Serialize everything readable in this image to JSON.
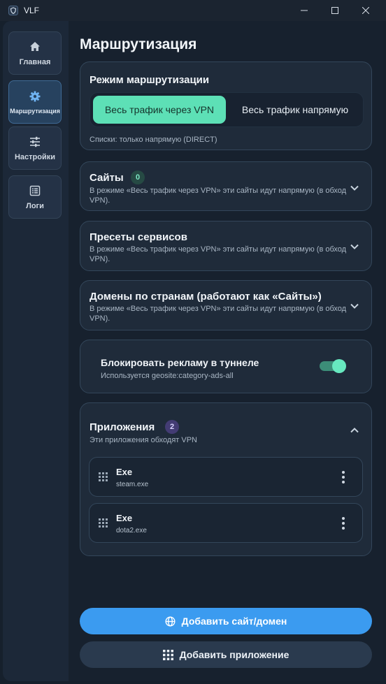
{
  "window": {
    "title": "VLF"
  },
  "sidebar": {
    "items": [
      {
        "label": "Главная",
        "icon": "home-icon"
      },
      {
        "label": "Маршрутизация",
        "icon": "gear-icon"
      },
      {
        "label": "Настройки",
        "icon": "sliders-icon"
      },
      {
        "label": "Логи",
        "icon": "list-icon"
      }
    ],
    "active_index": 1
  },
  "page": {
    "title": "Маршрутизация"
  },
  "routing_mode": {
    "title": "Режим маршрутизации",
    "options": [
      "Весь трафик через VPN",
      "Весь трафик напрямую"
    ],
    "selected": "Весь трафик через VPN",
    "note": "Списки: только напрямую (DIRECT)"
  },
  "sites": {
    "title": "Сайты",
    "count": "0",
    "description": "В режиме «Весь трафик через VPN» эти сайты идут напрямую (в обход VPN)."
  },
  "presets": {
    "title": "Пресеты сервисов",
    "description": "В режиме «Весь трафик через VPN» эти сайты идут напрямую (в обход VPN)."
  },
  "country_domains": {
    "title": "Домены по странам (работают как «Сайты»)",
    "description": "В режиме «Весь трафик через VPN» эти сайты идут напрямую (в обход VPN)."
  },
  "adblock": {
    "title": "Блокировать рекламу в туннеле",
    "subtitle": "Используется geosite:category-ads-all",
    "enabled": true
  },
  "apps": {
    "title": "Приложения",
    "count": "2",
    "subtitle": "Эти приложения обходят VPN",
    "items": [
      {
        "type": "Exe",
        "file": "steam.exe"
      },
      {
        "type": "Exe",
        "file": "dota2.exe"
      }
    ]
  },
  "actions": {
    "add_site": "Добавить сайт/домен",
    "add_app": "Добавить приложение"
  },
  "colors": {
    "accent_green": "#5de0b6",
    "accent_blue": "#3b9bf0",
    "badge_purple": "#433c74"
  }
}
